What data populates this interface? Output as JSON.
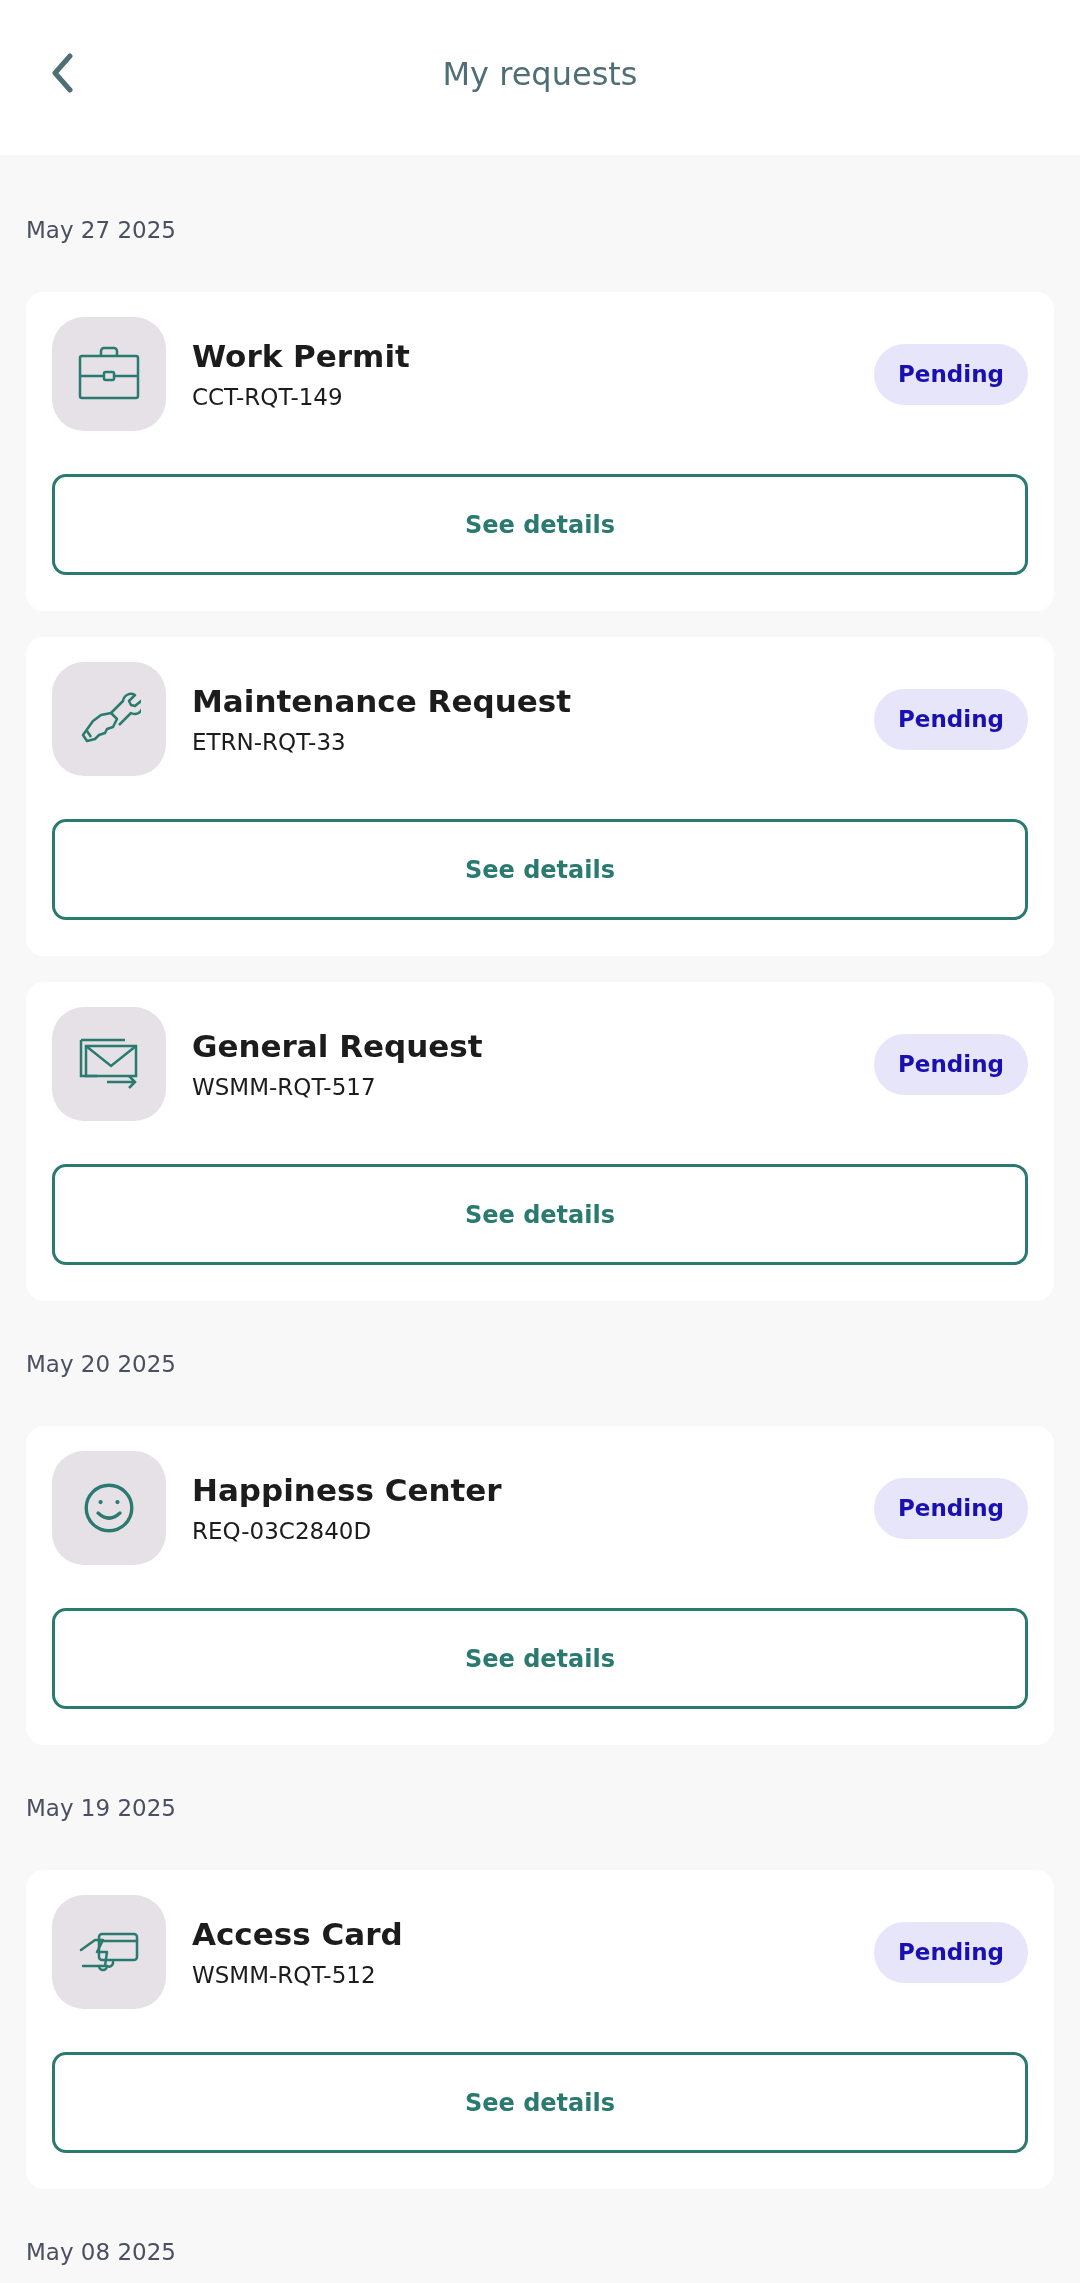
{
  "header": {
    "title": "My requests"
  },
  "sections": [
    {
      "date": "May 27 2025",
      "requests": [
        {
          "title": "Work Permit",
          "code": "CCT-RQT-149",
          "status": "Pending",
          "kind": "briefcase",
          "action": "See details"
        },
        {
          "title": "Maintenance Request",
          "code": "ETRN-RQT-33",
          "status": "Pending",
          "kind": "wrench",
          "action": "See details"
        },
        {
          "title": "General Request",
          "code": "WSMM-RQT-517",
          "status": "Pending",
          "kind": "mail",
          "action": "See details"
        }
      ]
    },
    {
      "date": "May 20 2025",
      "requests": [
        {
          "title": "Happiness Center",
          "code": "REQ-03C2840D",
          "status": "Pending",
          "kind": "smile",
          "action": "See details"
        }
      ]
    },
    {
      "date": "May 19 2025",
      "requests": [
        {
          "title": "Access Card",
          "code": "WSMM-RQT-512",
          "status": "Pending",
          "kind": "card",
          "action": "See details"
        }
      ]
    },
    {
      "date": "May 08 2025"
    }
  ]
}
